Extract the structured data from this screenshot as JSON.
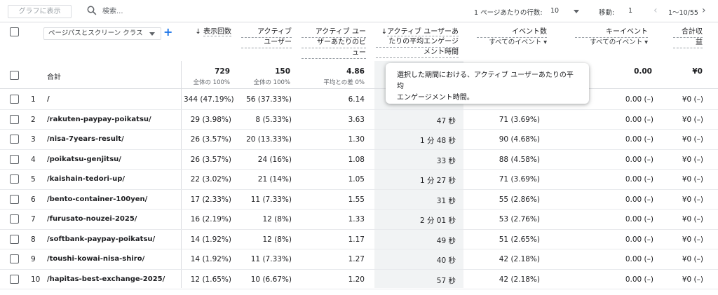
{
  "toolbar": {
    "graph_button": "グラフに表示",
    "search_placeholder": "検索...",
    "rows_per_page_label": "1 ページあたりの行数:",
    "rows_per_page_value": "10",
    "goto_label": "移動:",
    "goto_value": "1",
    "range_text": "1〜10/55"
  },
  "header": {
    "dimension_select": "ページパスとスクリーン クラス",
    "add_label": "+",
    "columns": {
      "views": "表示回数",
      "active_users_l1": "アクティブ",
      "active_users_l2": "ユーザー",
      "views_per_user_l1": "アクティブ ユー",
      "views_per_user_l2": "ザーあたりのビ",
      "views_per_user_l3": "ュー",
      "eng_time_l1": "アクティブ ユーザーあ",
      "eng_time_l2": "たりの平均エンゲージ",
      "eng_time_l3": "メント時間",
      "events_l1": "イベント数",
      "events_l2": "すべてのイベント",
      "key_events_l1": "キーイベント",
      "key_events_l2": "すべてのイベント",
      "revenue_l1": "合計収",
      "revenue_l2": "益"
    },
    "sort_arrow": "↓"
  },
  "totals": {
    "label": "合計",
    "views": "729",
    "views_sub": "全体の 100%",
    "active_users": "150",
    "active_users_sub": "全体の 100%",
    "views_per_user": "4.86",
    "views_per_user_sub": "平均との差 0%",
    "key_events": "0.00",
    "revenue": "¥0"
  },
  "tooltip": {
    "line1": "選択した期間における、アクティブ ユーザーあたりの平均",
    "line2": "エンゲージメント時間。"
  },
  "rows": [
    {
      "index": "1",
      "path": "/",
      "views": "344 (47.19%)",
      "users": "56 (37.33%)",
      "vpu": "6.14",
      "eng": "",
      "events": "",
      "key": "0.00 (–)",
      "rev": "¥0 (–)"
    },
    {
      "index": "2",
      "path": "/rakuten-paypay-poikatsu/",
      "views": "29 (3.98%)",
      "users": "8 (5.33%)",
      "vpu": "3.63",
      "eng": "47 秒",
      "events": "71 (3.69%)",
      "key": "0.00 (–)",
      "rev": "¥0 (–)"
    },
    {
      "index": "3",
      "path": "/nisa-7years-result/",
      "views": "26 (3.57%)",
      "users": "20 (13.33%)",
      "vpu": "1.30",
      "eng": "1 分 48 秒",
      "events": "90 (4.68%)",
      "key": "0.00 (–)",
      "rev": "¥0 (–)"
    },
    {
      "index": "4",
      "path": "/poikatsu-genjitsu/",
      "views": "26 (3.57%)",
      "users": "24 (16%)",
      "vpu": "1.08",
      "eng": "33 秒",
      "events": "88 (4.58%)",
      "key": "0.00 (–)",
      "rev": "¥0 (–)"
    },
    {
      "index": "5",
      "path": "/kaishain-tedori-up/",
      "views": "22 (3.02%)",
      "users": "21 (14%)",
      "vpu": "1.05",
      "eng": "1 分 27 秒",
      "events": "71 (3.69%)",
      "key": "0.00 (–)",
      "rev": "¥0 (–)"
    },
    {
      "index": "6",
      "path": "/bento-container-100yen/",
      "views": "17 (2.33%)",
      "users": "11 (7.33%)",
      "vpu": "1.55",
      "eng": "31 秒",
      "events": "55 (2.86%)",
      "key": "0.00 (–)",
      "rev": "¥0 (–)"
    },
    {
      "index": "7",
      "path": "/furusato-nouzei-2025/",
      "views": "16 (2.19%)",
      "users": "12 (8%)",
      "vpu": "1.33",
      "eng": "2 分 01 秒",
      "events": "53 (2.76%)",
      "key": "0.00 (–)",
      "rev": "¥0 (–)"
    },
    {
      "index": "8",
      "path": "/softbank-paypay-poikatsu/",
      "views": "14 (1.92%)",
      "users": "12 (8%)",
      "vpu": "1.17",
      "eng": "49 秒",
      "events": "51 (2.65%)",
      "key": "0.00 (–)",
      "rev": "¥0 (–)"
    },
    {
      "index": "9",
      "path": "/toushi-kowai-nisa-shiro/",
      "views": "14 (1.92%)",
      "users": "11 (7.33%)",
      "vpu": "1.27",
      "eng": "40 秒",
      "events": "42 (2.18%)",
      "key": "0.00 (–)",
      "rev": "¥0 (–)"
    },
    {
      "index": "10",
      "path": "/hapitas-best-exchange-2025/",
      "views": "12 (1.65%)",
      "users": "10 (6.67%)",
      "vpu": "1.20",
      "eng": "57 秒",
      "events": "42 (2.18%)",
      "key": "0.00 (–)",
      "rev": "¥0 (–)"
    }
  ],
  "colors": {
    "accent": "#1a73e8",
    "shade": "#f1f3f4",
    "border": "#dadce0"
  }
}
